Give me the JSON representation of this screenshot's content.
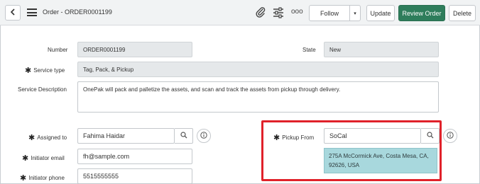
{
  "header": {
    "back_icon": "chevron-left-icon",
    "menu_icon": "hamburger-icon",
    "title": "Order - ORDER0001199",
    "attach_icon": "paperclip-icon",
    "settings_icon": "sliders-icon",
    "more_label": "ooo",
    "follow_label": "Follow",
    "caret_label": "▾",
    "update_label": "Update",
    "review_order_label": "Review Order",
    "delete_label": "Delete",
    "accent_color": "#2e7d5b"
  },
  "form": {
    "number": {
      "label": "Number",
      "value": "ORDER0001199"
    },
    "state": {
      "label": "State",
      "value": "New"
    },
    "service_type": {
      "required": "✱",
      "label": "Service type",
      "value": "Tag, Pack, & Pickup"
    },
    "service_description": {
      "label": "Service Description",
      "value": "OnePak will pack and palletize the assets, and scan and track the assets from pickup through delivery."
    },
    "assigned_to": {
      "required": "✱",
      "label": "Assigned to",
      "value": "Fahima Haidar"
    },
    "pickup_from": {
      "required": "✱",
      "label": "Pickup From",
      "value": "SoCal"
    },
    "pickup_address_line1": "275A McCormick Ave, Costa Mesa, CA,",
    "pickup_address_line2": "92626, USA",
    "initiator_email": {
      "required": "✱",
      "label": "Initiator email",
      "value": "fh@sample.com"
    },
    "initiator_phone": {
      "required": "✱",
      "label": "Initiator phone",
      "value": "5515555555"
    }
  },
  "highlight_color": "#e0212a",
  "suggestion_color": "#a8d8dd"
}
